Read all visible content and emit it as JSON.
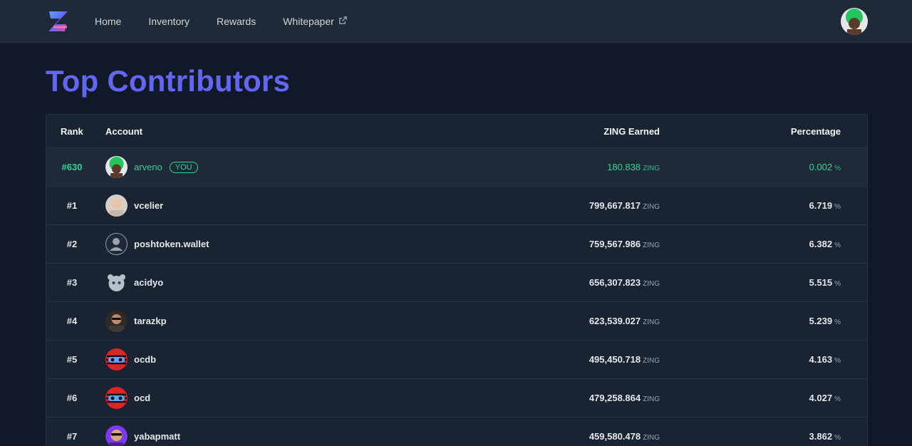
{
  "nav": {
    "links": [
      "Home",
      "Inventory",
      "Rewards",
      "Whitepaper"
    ],
    "logo_icon": "zing-logo-icon",
    "external_icon": "external-link-icon"
  },
  "page": {
    "title": "Top Contributors"
  },
  "table": {
    "headers": {
      "rank": "Rank",
      "account": "Account",
      "earned": "ZING Earned",
      "percentage": "Percentage"
    },
    "unit_token": "ZING",
    "unit_pct": "%",
    "you_label": "YOU",
    "you_row": {
      "rank": "#630",
      "account": "arveno",
      "earned": "180.838",
      "percentage": "0.002"
    },
    "rows": [
      {
        "rank": "#1",
        "account": "vcelier",
        "earned": "799,667.817",
        "percentage": "6.719"
      },
      {
        "rank": "#2",
        "account": "poshtoken.wallet",
        "earned": "759,567.986",
        "percentage": "6.382"
      },
      {
        "rank": "#3",
        "account": "acidyo",
        "earned": "656,307.823",
        "percentage": "5.515"
      },
      {
        "rank": "#4",
        "account": "tarazkp",
        "earned": "623,539.027",
        "percentage": "5.239"
      },
      {
        "rank": "#5",
        "account": "ocdb",
        "earned": "495,450.718",
        "percentage": "4.163"
      },
      {
        "rank": "#6",
        "account": "ocd",
        "earned": "479,258.864",
        "percentage": "4.027"
      },
      {
        "rank": "#7",
        "account": "yabapmatt",
        "earned": "459,580.478",
        "percentage": "3.862"
      }
    ]
  },
  "colors": {
    "accent": "#6366f1",
    "highlight": "#34d399",
    "bg": "#111827",
    "nav_bg": "#1f2937"
  }
}
